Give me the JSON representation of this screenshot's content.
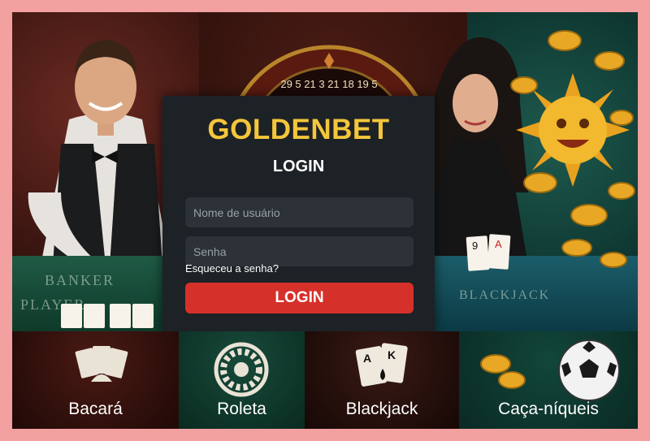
{
  "brand": {
    "name": "GOLDENBET"
  },
  "login": {
    "heading": "LOGIN",
    "username_placeholder": "Nome de usuário",
    "password_placeholder": "Senha",
    "forgot_label": "Esqueceu a senha?",
    "submit_label": "LOGIN"
  },
  "background": {
    "roulette_numbers": "29 5 21 3 21 18 19 5",
    "table_left_text_1": "BANKER",
    "table_left_text_2": "PLAYER",
    "table_right_text": "BLACKJACK"
  },
  "games": [
    {
      "label": "Bacará",
      "icon": "cards-icon"
    },
    {
      "label": "Roleta",
      "icon": "roulette-icon"
    },
    {
      "label": "Blackjack",
      "icon": "ace-king-icon"
    },
    {
      "label": "Caça-níqueis",
      "icon": "soccer-ball-icon"
    }
  ],
  "colors": {
    "brand": "#f4c63a",
    "button": "#d6302a",
    "panel": "#1d2226",
    "frame": "#f2a0a0"
  }
}
